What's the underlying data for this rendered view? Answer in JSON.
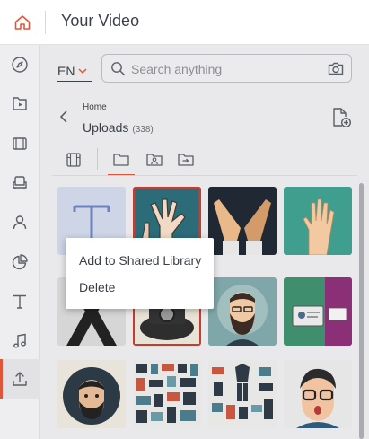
{
  "app": {
    "title": "Your Video"
  },
  "colors": {
    "accent": "#e0553a",
    "text": "#3b3f47",
    "muted": "#8c8f96"
  },
  "top_bar": {
    "home_icon": "home-icon"
  },
  "sidebar": {
    "items": [
      {
        "name": "explore",
        "icon": "compass-icon"
      },
      {
        "name": "my-videos",
        "icon": "video-file-icon"
      },
      {
        "name": "scenes",
        "icon": "film-icon"
      },
      {
        "name": "props",
        "icon": "armchair-icon"
      },
      {
        "name": "characters",
        "icon": "person-icon"
      },
      {
        "name": "charts",
        "icon": "pie-chart-icon"
      },
      {
        "name": "text",
        "icon": "text-icon"
      },
      {
        "name": "music",
        "icon": "music-icon"
      },
      {
        "name": "uploads",
        "icon": "upload-icon",
        "active": true
      }
    ]
  },
  "toolbar": {
    "language": "EN",
    "search": {
      "placeholder": "Search anything",
      "value": ""
    }
  },
  "breadcrumb": {
    "parent": "Home",
    "current": "Uploads",
    "count": "(338)"
  },
  "tabs": [
    {
      "name": "media",
      "icon": "film-strip-icon"
    },
    {
      "name": "folders",
      "icon": "folder-icon",
      "active": true
    },
    {
      "name": "shared",
      "icon": "shared-folder-icon"
    },
    {
      "name": "imported",
      "icon": "import-folder-icon"
    }
  ],
  "thumbnails": [
    {
      "name": "letter-t",
      "icon": "letter-t-image"
    },
    {
      "name": "hands-up",
      "icon": "hands-image"
    },
    {
      "name": "praying-hands",
      "icon": "hands-image"
    },
    {
      "name": "hand-raised",
      "icon": "hand-image"
    },
    {
      "name": "crossed-arms",
      "icon": "cross-image"
    },
    {
      "name": "camera-illustration",
      "icon": "camera-image"
    },
    {
      "name": "bearded-man",
      "icon": "avatar-image"
    },
    {
      "name": "monitor-scene",
      "icon": "monitor-image"
    },
    {
      "name": "man-portrait",
      "icon": "avatar-image"
    },
    {
      "name": "office-objects",
      "icon": "objects-image"
    },
    {
      "name": "clothing-items",
      "icon": "objects-image"
    },
    {
      "name": "surprised-man",
      "icon": "avatar-image"
    }
  ],
  "context_menu": {
    "items": [
      {
        "label": "Add to Shared Library"
      },
      {
        "label": "Delete"
      }
    ]
  }
}
